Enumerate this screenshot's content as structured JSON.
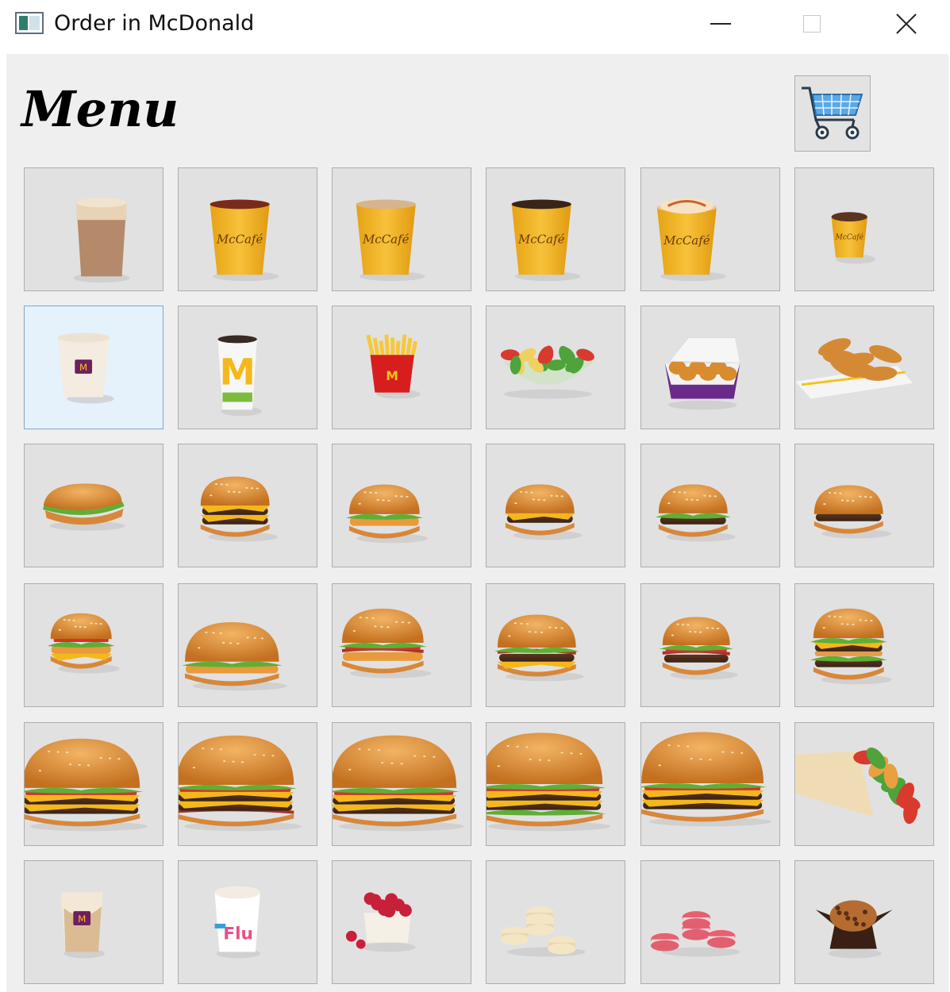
{
  "window": {
    "title": "Order in McDonald"
  },
  "header": {
    "menu_title": "Menu"
  },
  "icons": {
    "app": "window-app-icon",
    "minimize": "minimize-icon",
    "maximize": "maximize-icon",
    "close": "close-icon",
    "cart": "shopping-cart-icon"
  },
  "colors": {
    "client_bg": "#efefef",
    "tile_bg": "#e1e1e1",
    "tile_selected_bg": "#e5f1fb",
    "mccafe_yellow": "#f3b41b",
    "mcd_red": "#d71e1e",
    "bun": "#d98a33",
    "cart_blue": "#3a86c8"
  },
  "menu_items": [
    "latte-glass",
    "mccafe-tea-cup",
    "mccafe-cappuccino-cup",
    "mccafe-coffee-cup",
    "mccafe-caramel-latte-cup",
    "mccafe-small-espresso-cup",
    "vanilla-shake",
    "mcd-soft-drink-cup",
    "french-fries",
    "garden-salad",
    "chicken-nuggets-box",
    "chicken-tenders",
    "chicken-sub-sandwich",
    "double-cheeseburger",
    "mcchicken-burger",
    "cheeseburger",
    "hamburger-with-onions",
    "plain-hamburger",
    "grilled-chicken-burger",
    "big-chicken-sandwich",
    "crispy-chicken-bacon-burger",
    "bacon-double-burger",
    "beef-tomato-burger",
    "big-mac",
    "double-cheese-deluxe",
    "double-bacon-onion-burger",
    "quarter-pounder-deluxe",
    "big-tasty-double",
    "signature-beef-burger",
    "chicken-wrap",
    "caramel-frappe",
    "mcflurry",
    "raspberry-dessert",
    "vanilla-macarons",
    "raspberry-macarons",
    "chocolate-muffin"
  ]
}
